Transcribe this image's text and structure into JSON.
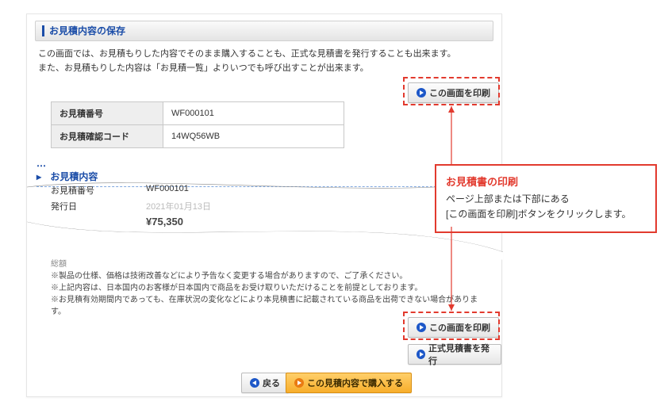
{
  "title_bar": "お見積内容の保存",
  "intro": {
    "line1": "この画面では、お見積もりした内容でそのまま購入することも、正式な見積書を発行することも出来ます。",
    "line2": "また、お見積もりした内容は「お見積一覧」よりいつでも呼び出すことが出来ます。"
  },
  "info_table": {
    "rows": [
      {
        "key": "お見積番号",
        "value": "WF000101"
      },
      {
        "key": "お見積確認コード",
        "value": "14WQ56WB"
      }
    ]
  },
  "section_head": "お見積内容",
  "details": {
    "rows": [
      {
        "key": "お見積番号",
        "value": "WF000101"
      },
      {
        "key": "発行日",
        "value": "2021年01月13日"
      }
    ],
    "price_label": "¥75,350"
  },
  "notes": {
    "total_label": "総額",
    "line1": "※製品の仕様、価格は技術改善などにより予告なく変更する場合がありますので、ご了承ください。",
    "line2": "※上記内容は、日本国内のお客様が日本国内で商品をお受け取りいただけることを前提としております。",
    "line3": "※お見積有効期間内であっても、在庫状況の変化などにより本見積書に記載されている商品を出荷できない場合があります。"
  },
  "buttons": {
    "print": "この画面を印刷",
    "issue": "正式見積書を発行",
    "back": "戻る",
    "buy": "この見積内容で購入する"
  },
  "callout": {
    "title": "お見積書の印刷",
    "body1": "ページ上部または下部にある",
    "body2": "[この画面を印刷]ボタンをクリックします。"
  }
}
